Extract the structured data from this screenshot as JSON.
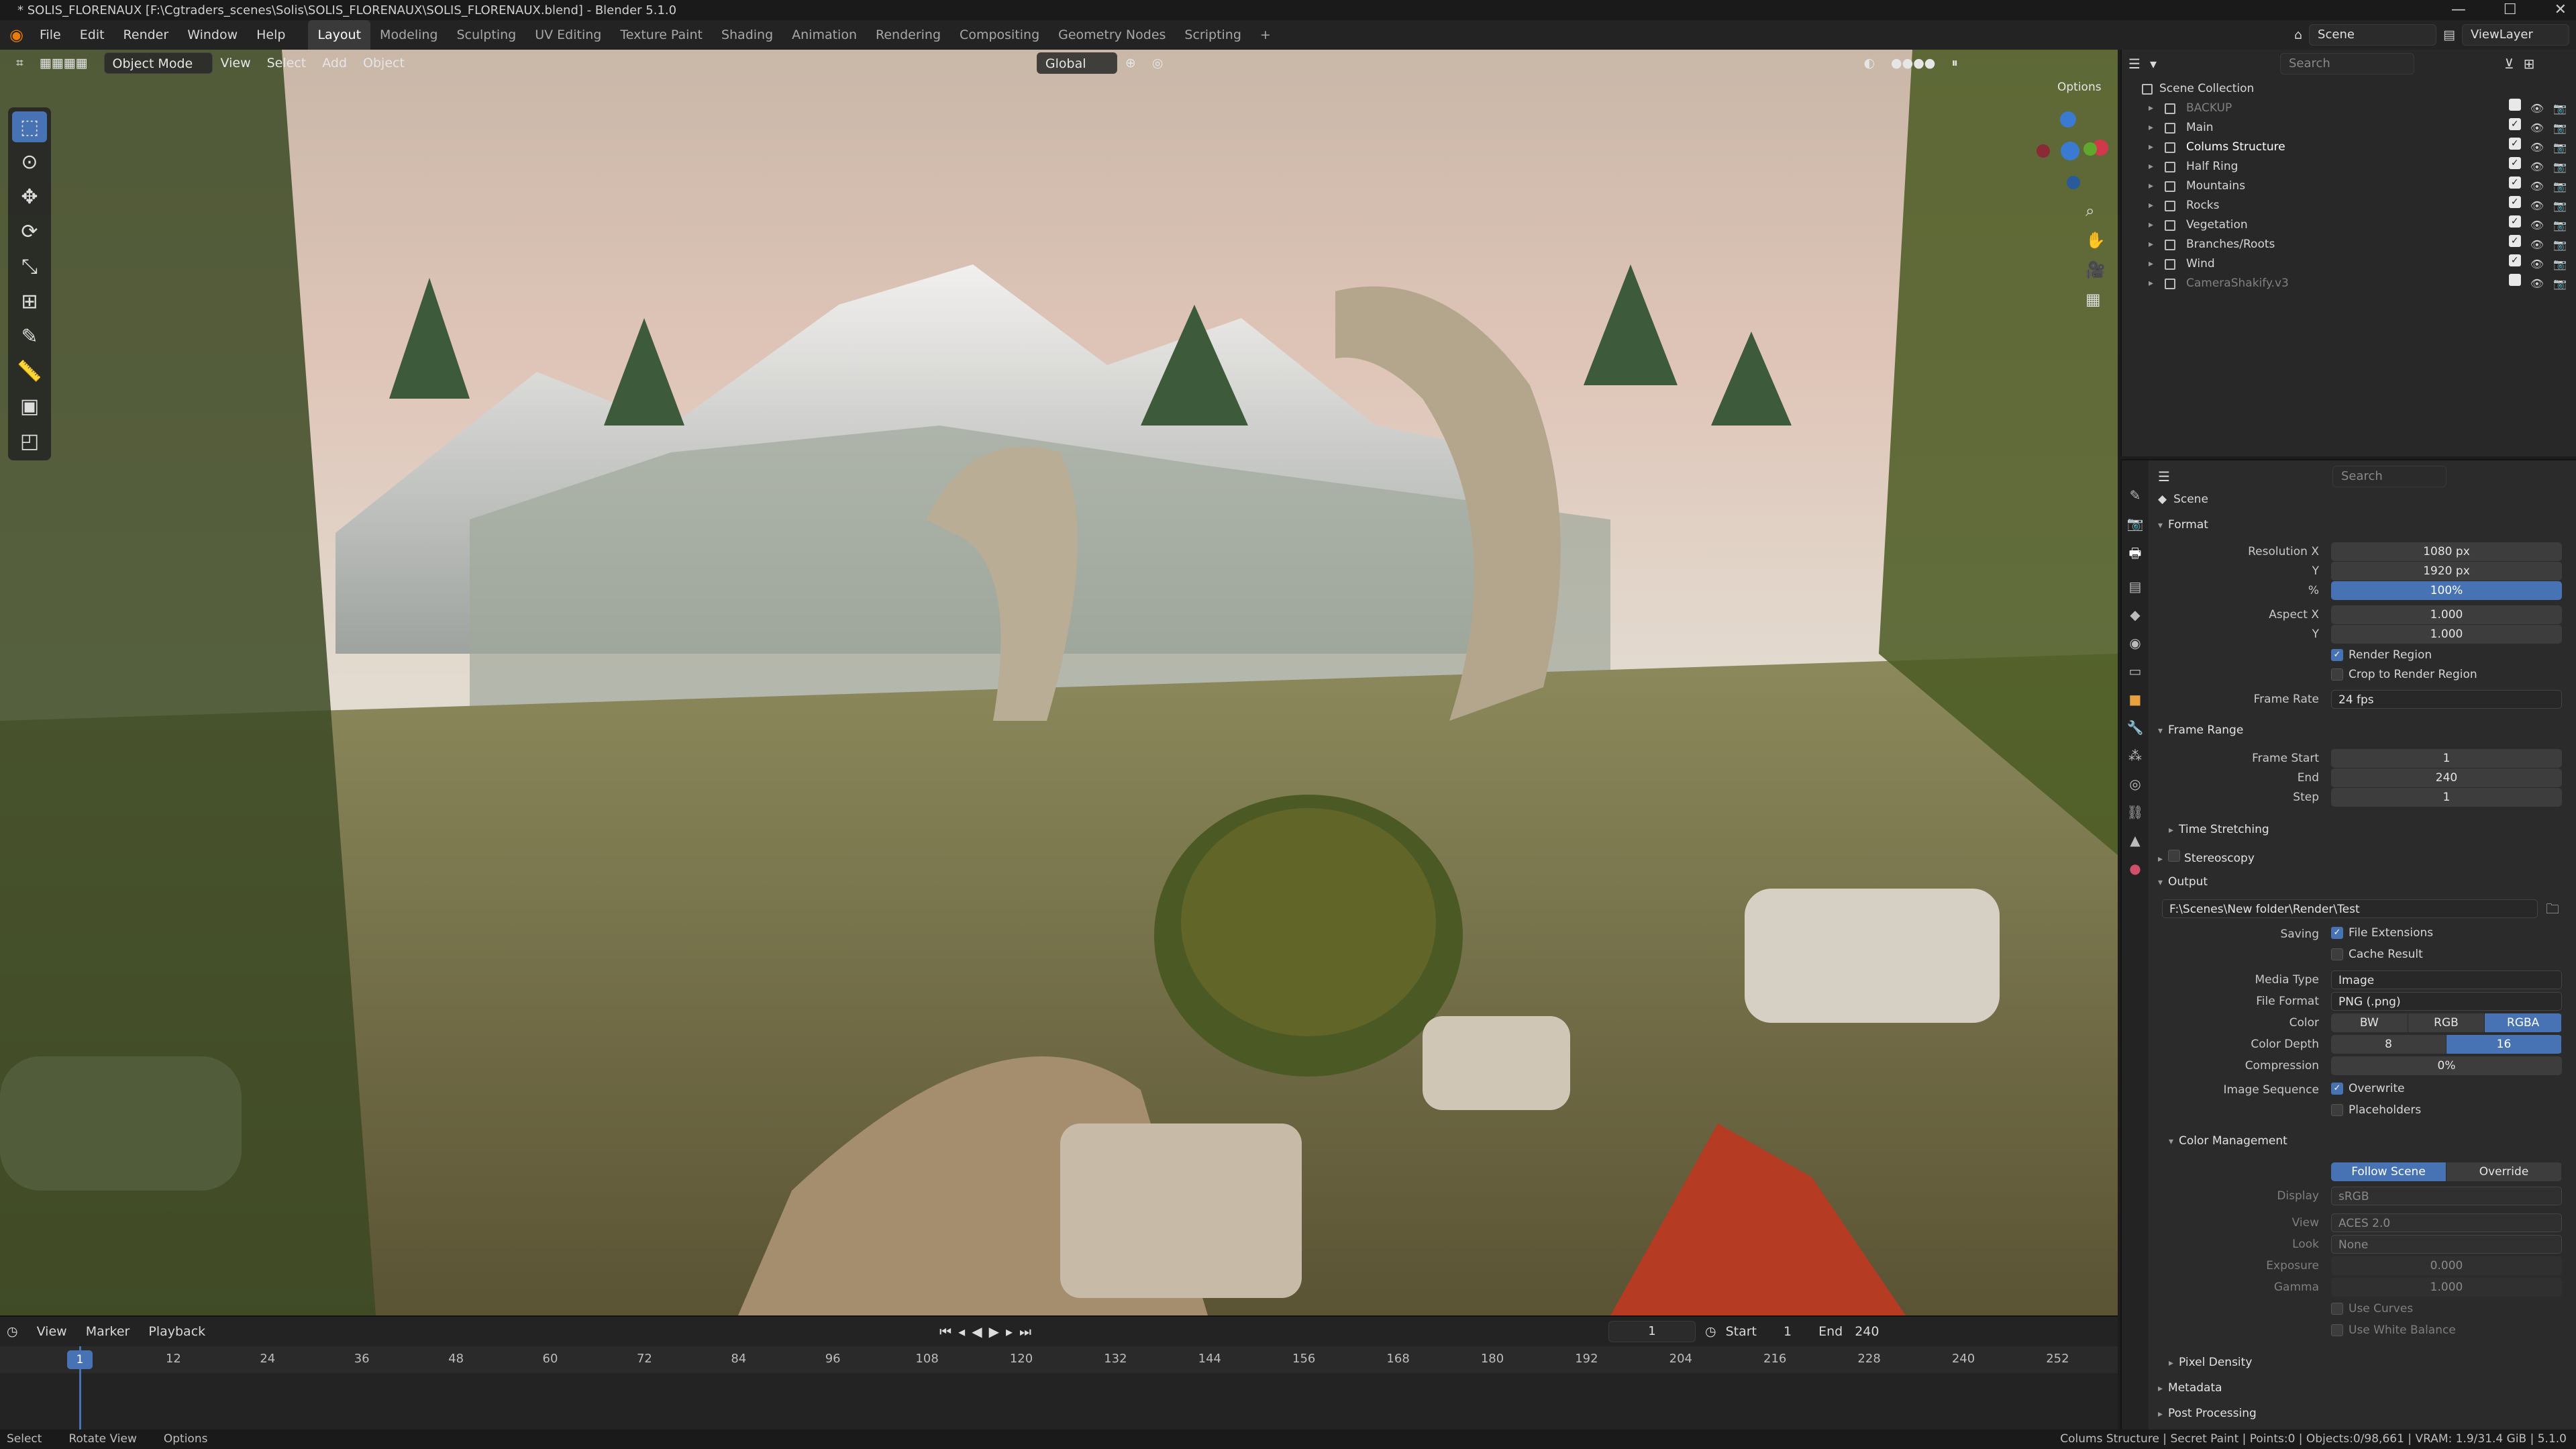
{
  "window": {
    "title": "* SOLIS_FLORENAUX [F:\\Cgtraders_scenes\\Solis\\SOLIS_FLORENAUX\\SOLIS_FLORENAUX.blend] - Blender 5.1.0",
    "minimize": "—",
    "maximize": "☐",
    "close": "✕"
  },
  "menu": {
    "items": [
      "File",
      "Edit",
      "Render",
      "Window",
      "Help"
    ],
    "workspaces": [
      "Layout",
      "Modeling",
      "Sculpting",
      "UV Editing",
      "Texture Paint",
      "Shading",
      "Animation",
      "Rendering",
      "Compositing",
      "Geometry Nodes",
      "Scripting"
    ],
    "add_workspace": "+",
    "scene": "Scene",
    "view_layer": "ViewLayer"
  },
  "viewport": {
    "mode": "Object Mode",
    "menus": [
      "View",
      "Select",
      "Add",
      "Object"
    ],
    "orientation": "Global",
    "options": "Options"
  },
  "outliner": {
    "search_placeholder": "Search",
    "root": "Scene Collection",
    "collections": [
      {
        "name": "BACKUP",
        "dim": true
      },
      {
        "name": "Main"
      },
      {
        "name": "Colums Structure",
        "bold": true
      },
      {
        "name": "Half Ring"
      },
      {
        "name": "Mountains"
      },
      {
        "name": "Rocks"
      },
      {
        "name": "Vegetation"
      },
      {
        "name": "Branches/Roots"
      },
      {
        "name": "Wind"
      },
      {
        "name": "CameraShakify.v3",
        "dim": true
      }
    ]
  },
  "properties": {
    "search_placeholder": "Search",
    "context": "Scene",
    "format": {
      "title": "Format",
      "resolution_x_label": "Resolution X",
      "resolution_x": "1080 px",
      "resolution_y_label": "Y",
      "resolution_y": "1920 px",
      "percent_label": "%",
      "percent": "100%",
      "aspect_x_label": "Aspect X",
      "aspect_x": "1.000",
      "aspect_y_label": "Y",
      "aspect_y": "1.000",
      "render_region": "Render Region",
      "crop_region": "Crop to Render Region",
      "frame_rate_label": "Frame Rate",
      "frame_rate": "24 fps"
    },
    "frame_range": {
      "title": "Frame Range",
      "start_label": "Frame Start",
      "start": "1",
      "end_label": "End",
      "end": "240",
      "step_label": "Step",
      "step": "1",
      "time_stretching": "Time Stretching"
    },
    "stereoscopy": "Stereoscopy",
    "output": {
      "title": "Output",
      "path": "F:\\Scenes\\New folder\\Render\\Test",
      "saving_label": "Saving",
      "file_extensions": "File Extensions",
      "cache_result": "Cache Result",
      "media_type_label": "Media Type",
      "media_type": "Image",
      "file_format_label": "File Format",
      "file_format": "PNG (.png)",
      "color_label": "Color",
      "color_options": [
        "BW",
        "RGB",
        "RGBA"
      ],
      "depth_label": "Color Depth",
      "depth_options": [
        "8",
        "16"
      ],
      "compression_label": "Compression",
      "compression": "0%",
      "sequence_label": "Image Sequence",
      "overwrite": "Overwrite",
      "placeholders": "Placeholders"
    },
    "color_management": {
      "title": "Color Management",
      "options": [
        "Follow Scene",
        "Override"
      ],
      "display_label": "Display",
      "display": "sRGB",
      "view_label": "View",
      "view": "ACES 2.0",
      "look_label": "Look",
      "look": "None",
      "exposure_label": "Exposure",
      "exposure": "0.000",
      "gamma_label": "Gamma",
      "gamma": "1.000",
      "use_curves": "Use Curves",
      "use_white_balance": "Use White Balance"
    },
    "pixel_density": "Pixel Density",
    "metadata": "Metadata",
    "post_processing": "Post Processing"
  },
  "timeline": {
    "menus": [
      "View",
      "Marker",
      "Playback"
    ],
    "current_frame": "1",
    "start_label": "Start",
    "start": "1",
    "end_label": "End",
    "end": "240",
    "ticks": [
      "12",
      "24",
      "36",
      "48",
      "60",
      "72",
      "84",
      "96",
      "108",
      "120",
      "132",
      "144",
      "156",
      "168",
      "180",
      "192",
      "204",
      "216",
      "228",
      "240",
      "252"
    ],
    "playhead_label": "1"
  },
  "status": {
    "select": "Select",
    "rotate": "Rotate View",
    "options": "Options",
    "info": "Colums Structure | Secret Paint | Points:0 | Objects:0/98,661 | VRAM: 1.9/31.4 GiB | 5.1.0"
  }
}
